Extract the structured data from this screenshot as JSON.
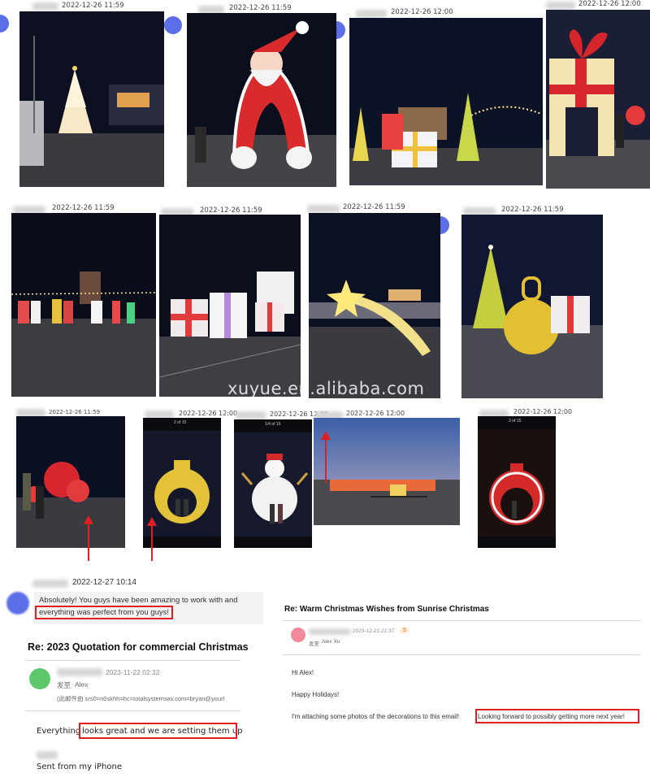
{
  "gallery": {
    "timestamps": [
      "2022-12-26 11:59",
      "2022-12-26 11:59",
      "2022-12-26 12:00",
      "2022-12-26 12:00",
      "2022-12-26 11:59",
      "2022-12-26 11:59",
      "2022-12-26 11:59",
      "2022-12-26 11:59",
      "2022-12-26 11:59",
      "2022-12-26 12:00",
      "2022-12-26 12:00",
      "2022-12-26 12:00",
      "2022-12-26 12:00"
    ],
    "phone_counters": [
      "2 of 15",
      "1/4 of 15",
      "3 of 15"
    ],
    "watermark": "xuyue.en.alibaba.com"
  },
  "chat": {
    "timestamp": "2022-12-27 10:14",
    "line1": "Absolutely! You guys have been amazing to work with and",
    "line2": "everything was perfect from you guys!"
  },
  "email_left": {
    "subject": "Re: 2023 Quotation for commercial Christmas",
    "date": "2023-11-22 02:32",
    "to_label": "发至",
    "to_name": "Alex",
    "forward_note": "(此邮件由 srs0=n0skhh=hc=totalsystemsav.com=bryan@yourl",
    "body_prefix": "Everything ",
    "body_highlight": "looks great and we are setting them up",
    "signature": "Sent from my iPhone"
  },
  "email_right": {
    "subject": "Re: Warm Christmas Wishes from Sunrise Christmas",
    "date": "2023-12-21 21:37",
    "badge": "5",
    "to_label": "发至",
    "to_name": "Alex Xu",
    "greeting": "Hi Alex!",
    "line1": "Happy Holidays!",
    "body_prefix": "I'm attaching some photos of the decorations to this email!",
    "body_highlight": "Looking forward to possibly getting more next year!"
  },
  "colors": {
    "highlight": "#e02020",
    "avatar_blue": "#5b6ee8",
    "avatar_green": "#5cc86a",
    "avatar_pink": "#f08a9a"
  }
}
